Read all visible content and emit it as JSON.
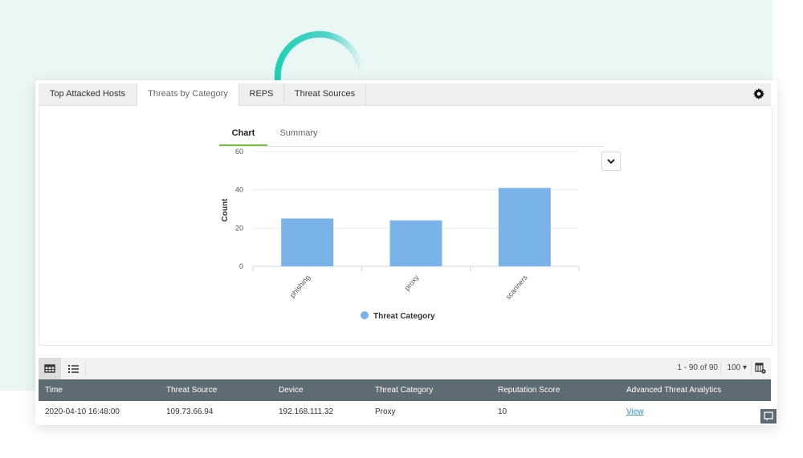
{
  "tabs": [
    {
      "label": "Top Attacked Hosts",
      "active": false
    },
    {
      "label": "Threats by Category",
      "active": true
    },
    {
      "label": "REPS",
      "active": false
    },
    {
      "label": "Threat Sources",
      "active": false
    }
  ],
  "icons": {
    "settings": "gear-icon",
    "dropdown": "chevron-down-icon",
    "grid_view": "grid-view-icon",
    "list_view": "list-view-icon",
    "column_settings": "column-settings-icon",
    "chat": "chat-icon"
  },
  "subtabs": [
    {
      "label": "Chart",
      "active": true
    },
    {
      "label": "Summary",
      "active": false
    }
  ],
  "colors": {
    "bar": "#7ab3ea",
    "accent_green": "#7ac043",
    "header_bg": "#5e6b73",
    "link": "#2a8fd4",
    "arc": "#1ed2b4"
  },
  "chart_data": {
    "type": "bar",
    "title": "",
    "xlabel": "",
    "ylabel": "Count",
    "categories": [
      "phishing",
      "proxy",
      "scanners"
    ],
    "series": [
      {
        "name": "Threat Category",
        "values": [
          25,
          24,
          41
        ]
      }
    ],
    "ylim": [
      0,
      60
    ],
    "yticks": [
      0,
      20,
      40,
      60
    ],
    "grid": true,
    "legend": "bottom-center"
  },
  "toolbar": {
    "pager_text": "1 - 90 of 90",
    "per_page": "100"
  },
  "table": {
    "columns": [
      "Time",
      "Threat Source",
      "Device",
      "Threat Category",
      "Reputation Score",
      "Advanced Threat Analytics"
    ],
    "rows": [
      [
        "2020-04-10 16:48:00",
        "109.73.66.94",
        "192.168.111.32",
        "Proxy",
        "10",
        "View"
      ]
    ]
  }
}
